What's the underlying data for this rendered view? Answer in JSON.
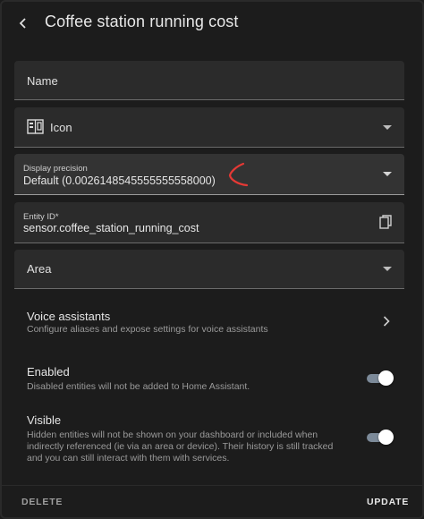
{
  "header": {
    "title": "Coffee station running cost"
  },
  "fields": {
    "name": {
      "label": "Name"
    },
    "icon": {
      "label": "Icon"
    },
    "display_precision": {
      "label": "Display precision",
      "value": "Default (0.0026148545555555558000)"
    },
    "entity_id": {
      "label": "Entity ID*",
      "value": "sensor.coffee_station_running_cost"
    },
    "area": {
      "label": "Area"
    }
  },
  "voice": {
    "title": "Voice assistants",
    "subtitle": "Configure aliases and expose settings for voice assistants"
  },
  "enabled": {
    "title": "Enabled",
    "subtitle": "Disabled entities will not be added to Home Assistant.",
    "on": true
  },
  "visible": {
    "title": "Visible",
    "subtitle_lines": [
      "Hidden entities will not be shown on your dashboard or included when",
      "indirectly referenced (ie via an area or device). Their history is still tracked",
      "and you can still interact with them with services."
    ],
    "on": true
  },
  "footer": {
    "delete_label": "DELETE",
    "update_label": "UPDATE"
  },
  "colors": {
    "accent": "#90caf9",
    "annotation": "#e53935"
  }
}
